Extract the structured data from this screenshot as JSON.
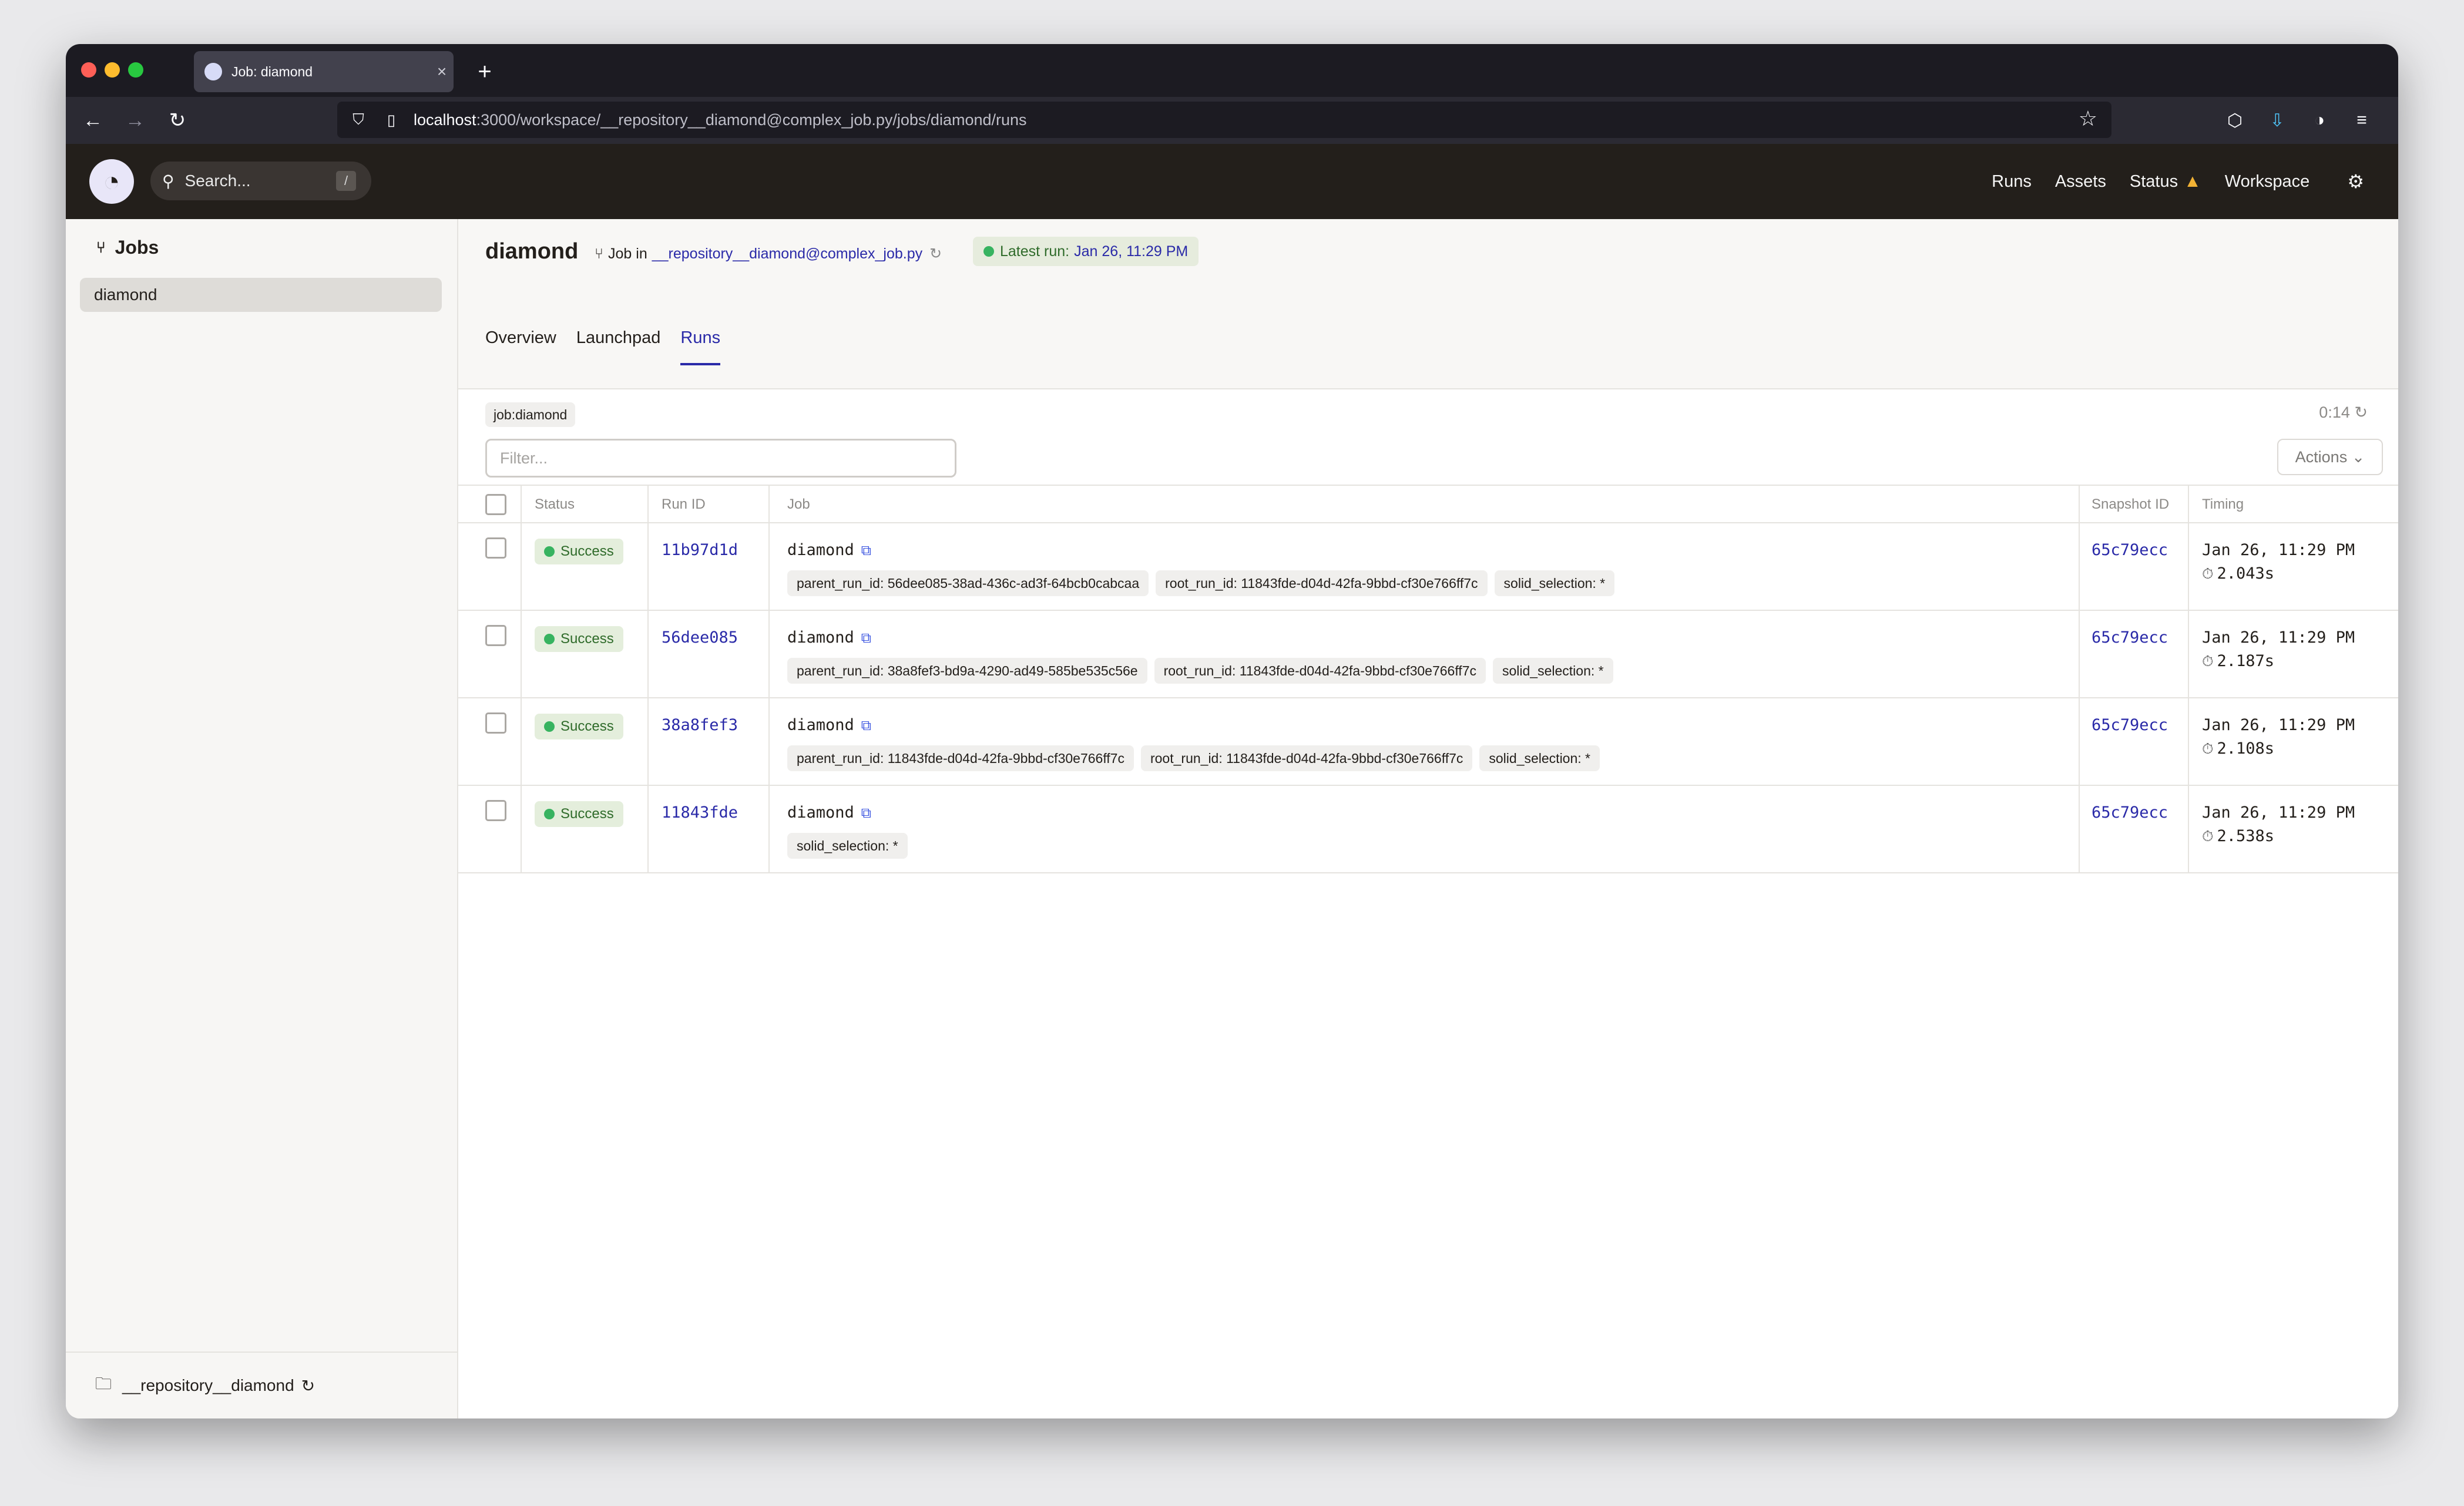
{
  "browser": {
    "tab_title": "Job: diamond",
    "url_host": "localhost",
    "url_path": ":3000/workspace/__repository__diamond@complex_job.py/jobs/diamond/runs"
  },
  "header": {
    "search_placeholder": "Search...",
    "search_shortcut": "/",
    "nav": {
      "runs": "Runs",
      "assets": "Assets",
      "status": "Status",
      "workspace": "Workspace"
    }
  },
  "sidebar": {
    "heading": "Jobs",
    "items": [
      {
        "label": "diamond"
      }
    ],
    "repository": "__repository__diamond"
  },
  "job": {
    "title": "diamond",
    "meta_prefix": "Job in",
    "repo_link": "__repository__diamond@complex_job.py",
    "latest_label": "Latest run:",
    "latest_value": "Jan 26, 11:29 PM",
    "tabs": [
      "Overview",
      "Launchpad",
      "Runs"
    ],
    "active_tab": "Runs"
  },
  "runs": {
    "filter_tag": "job:diamond",
    "refresh_countdown": "0:14",
    "filter_placeholder": "Filter...",
    "actions_label": "Actions",
    "columns": [
      "Status",
      "Run ID",
      "Job",
      "Snapshot ID",
      "Timing"
    ],
    "rows": [
      {
        "status": "Success",
        "run_id": "11b97d1d",
        "job": "diamond",
        "tags": [
          "parent_run_id: 56dee085-38ad-436c-ad3f-64bcb0cabcaa",
          "root_run_id: 11843fde-d04d-42fa-9bbd-cf30e766ff7c",
          "solid_selection: *"
        ],
        "snapshot": "65c79ecc",
        "date": "Jan 26, 11:29 PM",
        "duration": "2.043s"
      },
      {
        "status": "Success",
        "run_id": "56dee085",
        "job": "diamond",
        "tags": [
          "parent_run_id: 38a8fef3-bd9a-4290-ad49-585be535c56e",
          "root_run_id: 11843fde-d04d-42fa-9bbd-cf30e766ff7c",
          "solid_selection: *"
        ],
        "snapshot": "65c79ecc",
        "date": "Jan 26, 11:29 PM",
        "duration": "2.187s"
      },
      {
        "status": "Success",
        "run_id": "38a8fef3",
        "job": "diamond",
        "tags": [
          "parent_run_id: 11843fde-d04d-42fa-9bbd-cf30e766ff7c",
          "root_run_id: 11843fde-d04d-42fa-9bbd-cf30e766ff7c",
          "solid_selection: *"
        ],
        "snapshot": "65c79ecc",
        "date": "Jan 26, 11:29 PM",
        "duration": "2.108s"
      },
      {
        "status": "Success",
        "run_id": "11843fde",
        "job": "diamond",
        "tags": [
          "solid_selection: *"
        ],
        "snapshot": "65c79ecc",
        "date": "Jan 26, 11:29 PM",
        "duration": "2.538s"
      }
    ]
  },
  "colors": {
    "accent": "#2a2aa8",
    "success": "#37b360",
    "header_bg": "#231f1b",
    "warning": "#f2b234"
  },
  "icons": [
    "search-icon",
    "warning-icon",
    "gear-icon",
    "job-icon",
    "folder-icon",
    "reload-icon",
    "external-link-icon",
    "clock-icon",
    "chevron-down-icon"
  ]
}
